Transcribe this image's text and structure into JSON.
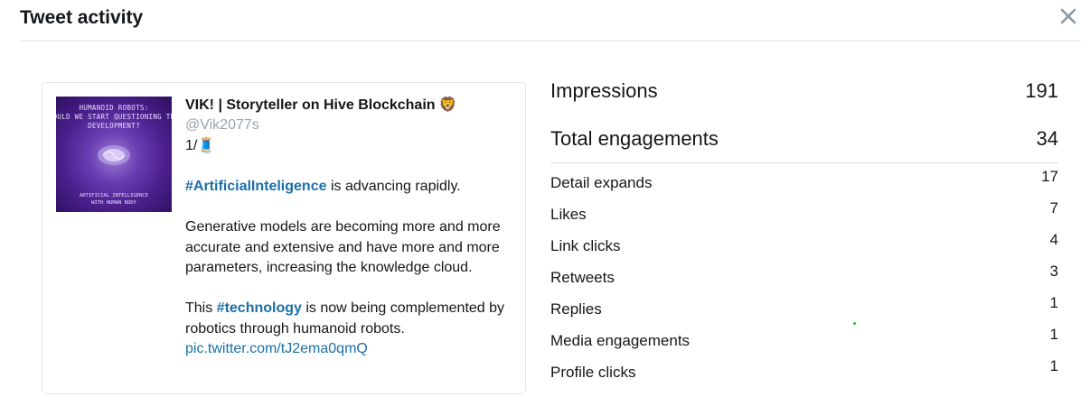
{
  "header": {
    "title": "Tweet activity"
  },
  "tweet": {
    "thumbnail": {
      "headline": "HUMANOID ROBOTS:\nOULD WE START QUESTIONING TH\nDEVELOPMENT?",
      "footer": "ARTIFICIAL INTELLIGENCE\nWITH HUMAN BODY"
    },
    "author_name": "VIK! | Storyteller on Hive Blockchain",
    "author_emoji": "🦁",
    "handle": "@Vik2077s",
    "line1": "1/🧵",
    "hashtag1": "#ArtificialInteligence",
    "line2_rest": " is advancing rapidly.",
    "paragraph2": "Generative models are becoming more and more accurate and extensive and have more and more parameters, increasing the knowledge cloud.",
    "line3_start": "This ",
    "hashtag2": "#technology",
    "line3_rest": " is now being complemented by robotics through humanoid robots.",
    "link": "pic.twitter.com/tJ2ema0qmQ"
  },
  "stats": {
    "impressions_label": "Impressions",
    "impressions_value": "191",
    "engagements_label": "Total engagements",
    "engagements_value": "34",
    "rows": [
      {
        "label": "Detail expands",
        "value": "17"
      },
      {
        "label": "Likes",
        "value": "7"
      },
      {
        "label": "Link clicks",
        "value": "4"
      },
      {
        "label": "Retweets",
        "value": "3"
      },
      {
        "label": "Replies",
        "value": "1"
      },
      {
        "label": "Media engagements",
        "value": "1"
      },
      {
        "label": "Profile clicks",
        "value": "1"
      }
    ]
  },
  "colors": {
    "link": "#1b6fa8",
    "handle": "#9aa3ab",
    "divider": "#d9dde0"
  }
}
